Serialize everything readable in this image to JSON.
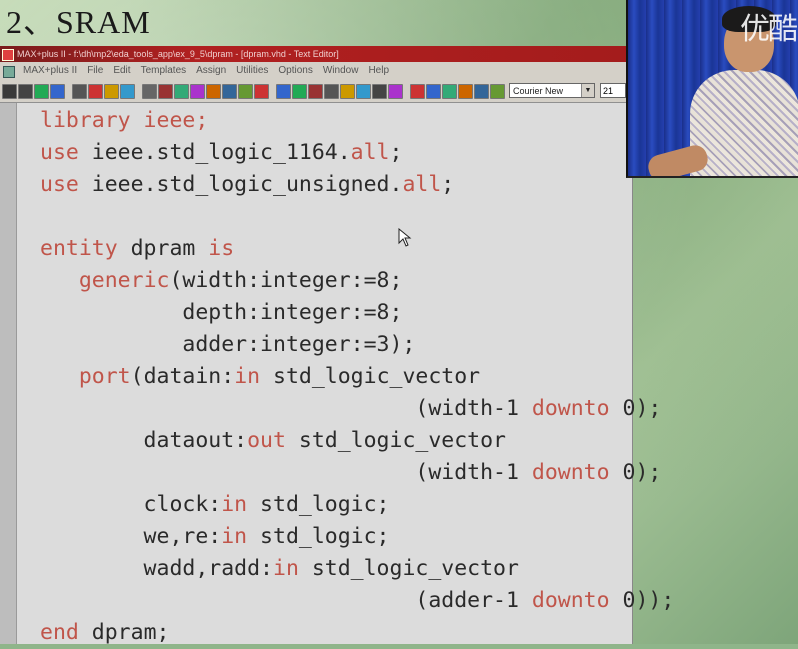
{
  "slide": {
    "title": "2、SRAM"
  },
  "window": {
    "title": "MAX+plus II - f:\\dh\\mp2\\eda_tools_app\\ex_9_5\\dpram - [dpram.vhd - Text Editor]"
  },
  "menubar": {
    "items": [
      "MAX+plus II",
      "File",
      "Edit",
      "Templates",
      "Assign",
      "Utilities",
      "Options",
      "Window",
      "Help"
    ]
  },
  "toolbar": {
    "font_name": "Courier New",
    "font_size": "21"
  },
  "video": {
    "watermark": "优酷"
  },
  "code": {
    "lines": [
      [
        {
          "t": "library ieee;",
          "k": true
        }
      ],
      [
        {
          "t": "use",
          "k": true
        },
        {
          "t": " ieee.std_logic_1164.",
          "k": false
        },
        {
          "t": "all",
          "k": true
        },
        {
          "t": ";",
          "k": false
        }
      ],
      [
        {
          "t": "use",
          "k": true
        },
        {
          "t": " ieee.std_logic_unsigned.",
          "k": false
        },
        {
          "t": "all",
          "k": true
        },
        {
          "t": ";",
          "k": false
        }
      ],
      [],
      [
        {
          "t": "entity",
          "k": true
        },
        {
          "t": " dpram ",
          "k": false
        },
        {
          "t": "is",
          "k": true
        }
      ],
      [
        {
          "t": "   ",
          "k": false
        },
        {
          "t": "generic",
          "k": true
        },
        {
          "t": "(width:integer:=8;",
          "k": false
        }
      ],
      [
        {
          "t": "           depth:integer:=8;",
          "k": false
        }
      ],
      [
        {
          "t": "           adder:integer:=3);",
          "k": false
        }
      ],
      [
        {
          "t": "   ",
          "k": false
        },
        {
          "t": "port",
          "k": true
        },
        {
          "t": "(datain:",
          "k": false
        },
        {
          "t": "in",
          "k": true
        },
        {
          "t": " std_logic_vector",
          "k": false
        }
      ],
      [
        {
          "t": "                             (width-1 ",
          "k": false
        },
        {
          "t": "downto",
          "k": true
        },
        {
          "t": " 0);",
          "k": false
        }
      ],
      [
        {
          "t": "        dataout:",
          "k": false
        },
        {
          "t": "out",
          "k": true
        },
        {
          "t": " std_logic_vector",
          "k": false
        }
      ],
      [
        {
          "t": "                             (width-1 ",
          "k": false
        },
        {
          "t": "downto",
          "k": true
        },
        {
          "t": " 0);",
          "k": false
        }
      ],
      [
        {
          "t": "        clock:",
          "k": false
        },
        {
          "t": "in",
          "k": true
        },
        {
          "t": " std_logic;",
          "k": false
        }
      ],
      [
        {
          "t": "        we,re:",
          "k": false
        },
        {
          "t": "in",
          "k": true
        },
        {
          "t": " std_logic;",
          "k": false
        }
      ],
      [
        {
          "t": "        wadd,radd:",
          "k": false
        },
        {
          "t": "in",
          "k": true
        },
        {
          "t": " std_logic_vector",
          "k": false
        }
      ],
      [
        {
          "t": "                             (adder-1 ",
          "k": false
        },
        {
          "t": "downto",
          "k": true
        },
        {
          "t": " 0));",
          "k": false
        }
      ],
      [
        {
          "t": "end",
          "k": true
        },
        {
          "t": " dpram;",
          "k": false
        }
      ]
    ]
  },
  "colors": {
    "keyword": "#c0554a",
    "text": "#2a2a2a",
    "titlebar": "#a41c1c"
  }
}
